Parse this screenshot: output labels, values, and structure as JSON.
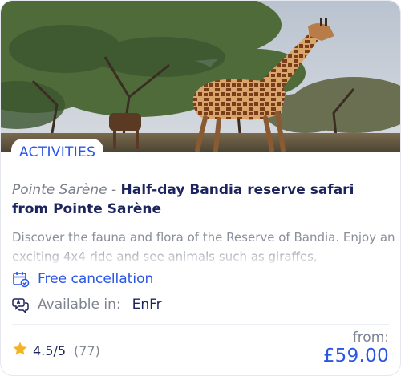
{
  "card": {
    "category": "ACTIVITIES",
    "location": "Pointe Sarène",
    "separator": " - ",
    "title": "Half-day Bandia reserve safari from Pointe Sarène",
    "description": "Discover the fauna and flora of the Reserve of Bandia. Enjoy an exciting 4x4 ride and see animals such as giraffes,",
    "features": {
      "cancellation": "Free cancellation",
      "languages_label": "Available in:",
      "languages_value": "EnFr"
    },
    "rating": {
      "score": "4.5/5",
      "count": "(77)",
      "value": 4.5
    },
    "price": {
      "from_label": "from:",
      "amount": "£59.00"
    }
  },
  "icons": {
    "hero": "giraffe-photo",
    "cancellation": "calendar-check-icon",
    "languages": "chat-bubbles-icon",
    "rating": "star-icon"
  },
  "colors": {
    "accent": "#2a55e6",
    "title": "#1b245c",
    "muted": "#7e8390",
    "star": "#f5b324"
  }
}
